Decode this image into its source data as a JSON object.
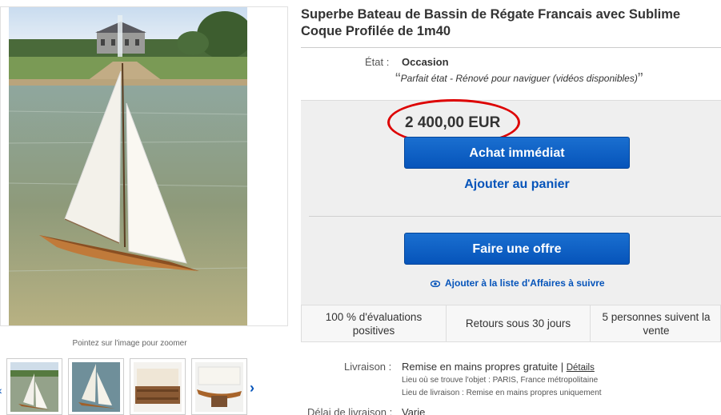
{
  "listing": {
    "title": "Superbe Bateau de Bassin de Régate Francais avec Sublime Coque Profilée de 1m40",
    "zoom_hint": "Pointez sur l'image pour zoomer"
  },
  "condition": {
    "label": "État :",
    "value": "Occasion",
    "note": "Parfait état - Rénové pour naviguer (vidéos disponibles)"
  },
  "buy": {
    "price": "2 400,00 EUR",
    "buy_now": "Achat immédiat",
    "add_to_cart": "Ajouter au panier",
    "make_offer": "Faire une offre",
    "watch": "Ajouter à la liste d'Affaires à suivre"
  },
  "badges": [
    {
      "line1": "100 % d'évaluations",
      "line2": "positives"
    },
    {
      "line1": "Retours sous 30 jours",
      "line2": ""
    },
    {
      "line1": "5 personnes suivent la",
      "line2": "vente"
    }
  ],
  "shipping": {
    "label": "Livraison :",
    "value": "Remise en mains propres gratuite |",
    "details_link": "Détails",
    "location": "Lieu où se trouve l'objet :  PARIS, France métropolitaine",
    "delivery_place": "Lieu de livraison :  Remise en mains propres uniquement",
    "delay_label": "Délai de livraison :",
    "delay_value": "Varie"
  },
  "colors": {
    "accent_blue": "#0654ba",
    "highlight_red": "#d00000"
  }
}
